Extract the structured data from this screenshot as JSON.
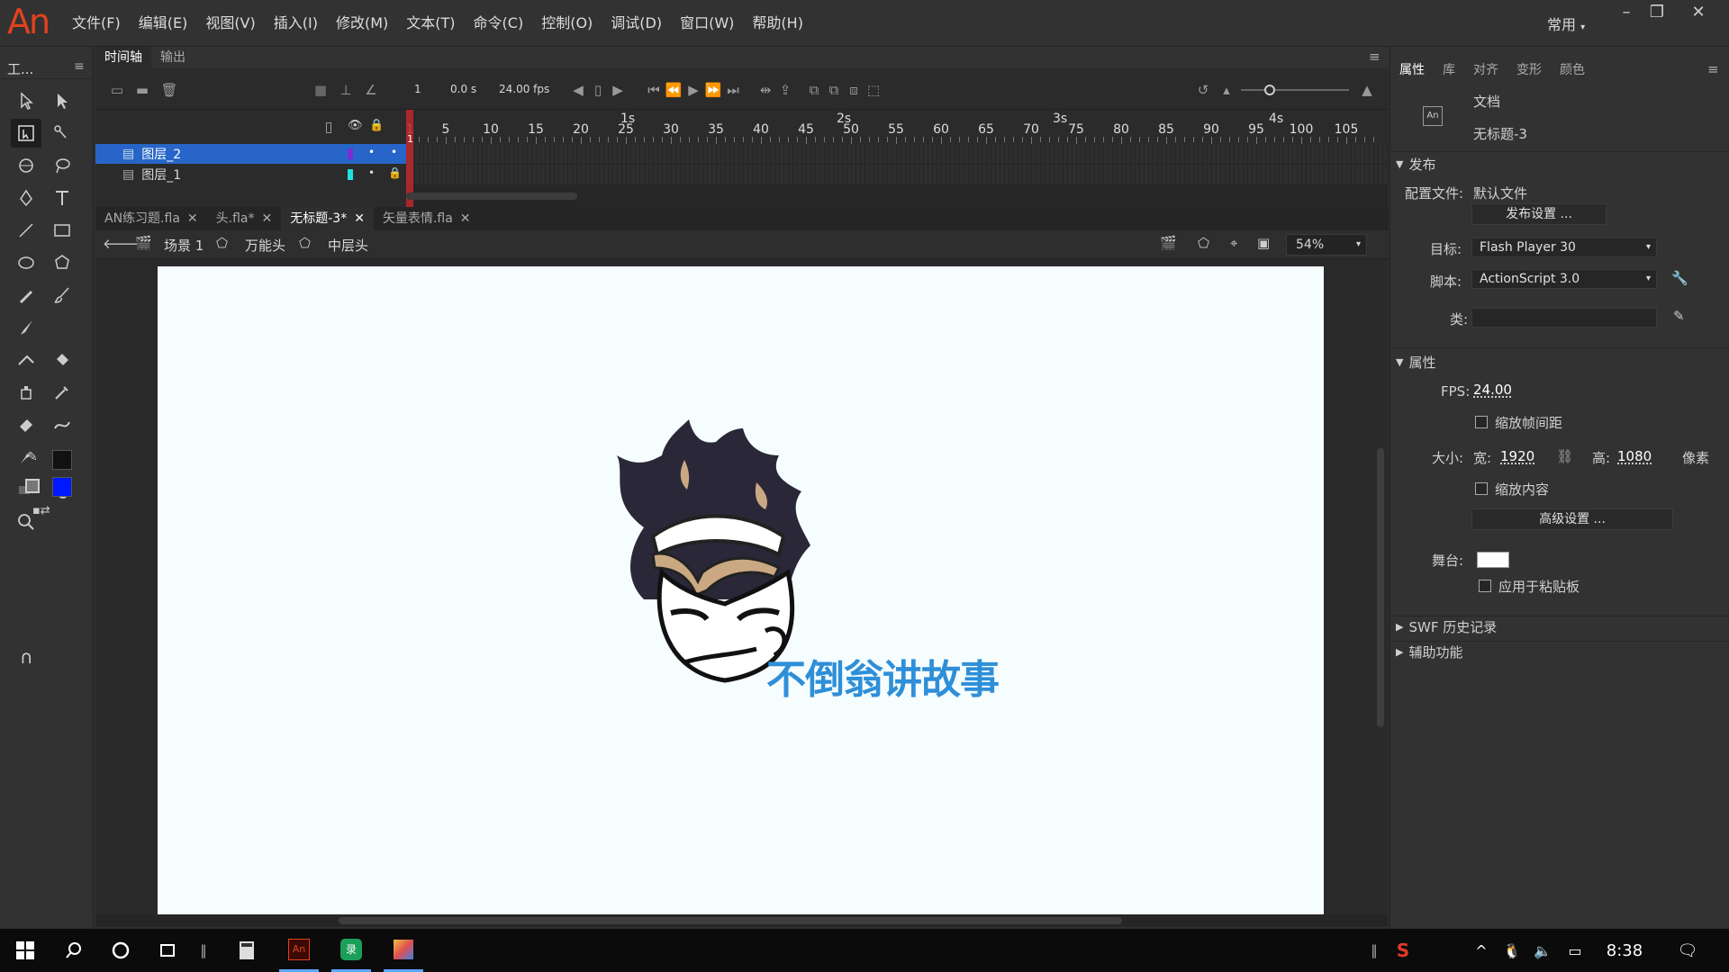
{
  "app": {
    "logo": "An"
  },
  "menu": {
    "items": [
      "文件(F)",
      "编辑(E)",
      "视图(V)",
      "插入(I)",
      "修改(M)",
      "文本(T)",
      "命令(C)",
      "控制(O)",
      "调试(D)",
      "窗口(W)",
      "帮助(H)"
    ],
    "workspace": "常用"
  },
  "toolbar": {
    "header": "工..."
  },
  "timeline": {
    "tabs": [
      "时间轴",
      "输出"
    ],
    "current_frame": "1",
    "time": "0.0 s",
    "fps": "24.00 fps",
    "seconds": [
      "1s",
      "2s",
      "3s",
      "4s"
    ],
    "frame_numbers": [
      "1",
      "5",
      "10",
      "15",
      "20",
      "25",
      "30",
      "35",
      "40",
      "45",
      "50",
      "55",
      "60",
      "65",
      "70",
      "75",
      "80",
      "85",
      "90",
      "95",
      "100",
      "105"
    ],
    "layers": [
      {
        "name": "图层_2",
        "selected": true,
        "color": "#7a2bd6"
      },
      {
        "name": "图层_1",
        "selected": false,
        "color": "#21e0e0"
      }
    ]
  },
  "documents": {
    "tabs": [
      "AN练习题.fla",
      "头.fla*",
      "无标题-3*",
      "矢量表情.fla"
    ],
    "active": 2
  },
  "editbar": {
    "crumbs": [
      "场景 1",
      "万能头",
      "中层头"
    ],
    "zoom": "54%"
  },
  "stage": {
    "caption": "不倒翁讲故事",
    "caption_color": "#2e8fd8",
    "background": "#f6fdfe"
  },
  "properties": {
    "tabs": [
      "属性",
      "库",
      "对齐",
      "变形",
      "颜色"
    ],
    "doc_label": "文档",
    "doc_name": "无标题-3",
    "publish": {
      "section": "发布",
      "profile_label": "配置文件:",
      "profile_value": "默认文件",
      "settings_button": "发布设置 ...",
      "target_label": "目标:",
      "target_value": "Flash Player 30",
      "script_label": "脚本:",
      "script_value": "ActionScript 3.0",
      "class_label": "类:"
    },
    "props": {
      "section": "属性",
      "fps_label": "FPS:",
      "fps_value": "24.00",
      "scale_interval": "缩放帧间距",
      "size_label": "大小:",
      "width_label": "宽:",
      "width_value": "1920",
      "height_label": "高:",
      "height_value": "1080",
      "unit": "像素",
      "scale_content": "缩放内容",
      "advanced_button": "高级设置 ...",
      "stage_label": "舞台:",
      "stage_color": "#ffffff",
      "apply_pasteboard": "应用于粘贴板"
    },
    "swf_history": "SWF 历史记录",
    "accessibility": "辅助功能"
  },
  "taskbar": {
    "time": "8:38"
  }
}
